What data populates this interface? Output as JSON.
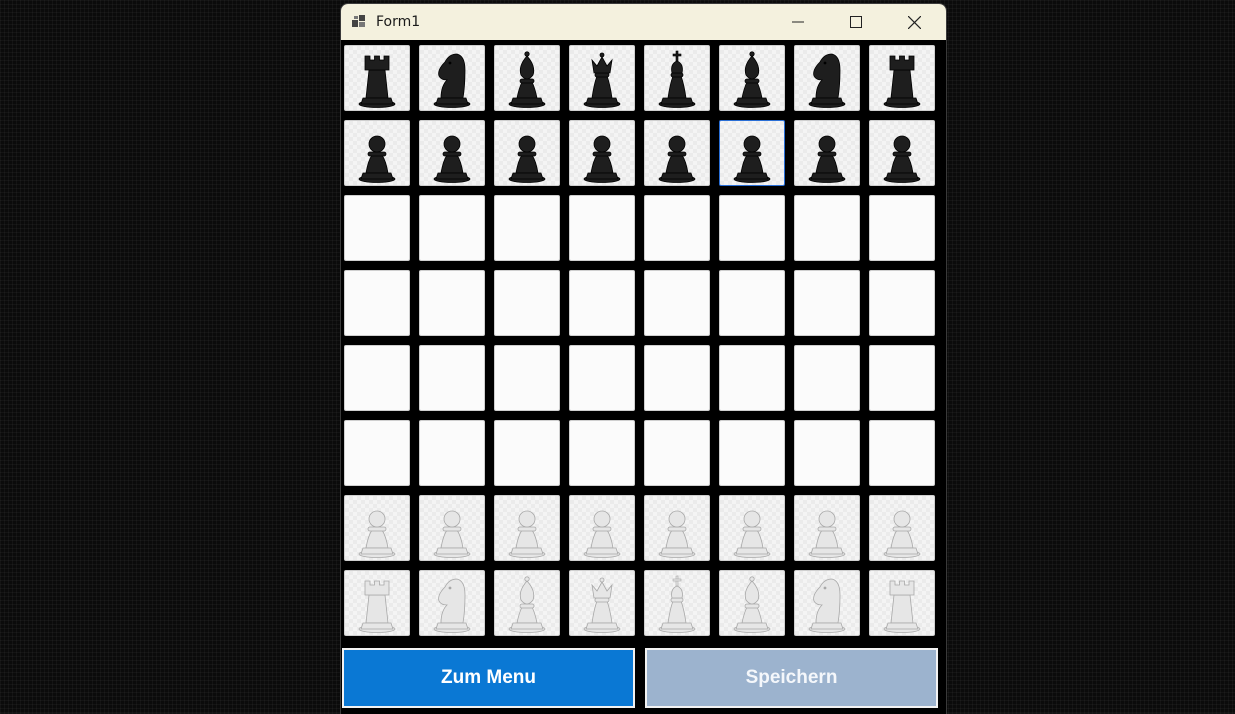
{
  "window": {
    "title": "Form1"
  },
  "board": {
    "rows": [
      [
        "black-rook",
        "black-knight",
        "black-bishop",
        "black-queen",
        "black-king",
        "black-bishop",
        "black-knight",
        "black-rook"
      ],
      [
        "black-pawn",
        "black-pawn",
        "black-pawn",
        "black-pawn",
        "black-pawn",
        "black-pawn",
        "black-pawn",
        "black-pawn"
      ],
      [
        "",
        "",
        "",
        "",
        "",
        "",
        "",
        ""
      ],
      [
        "",
        "",
        "",
        "",
        "",
        "",
        "",
        ""
      ],
      [
        "",
        "",
        "",
        "",
        "",
        "",
        "",
        ""
      ],
      [
        "",
        "",
        "",
        "",
        "",
        "",
        "",
        ""
      ],
      [
        "white-pawn",
        "white-pawn",
        "white-pawn",
        "white-pawn",
        "white-pawn",
        "white-pawn",
        "white-pawn",
        "white-pawn"
      ],
      [
        "white-rook",
        "white-knight",
        "white-bishop",
        "white-queen",
        "white-king",
        "white-bishop",
        "white-knight",
        "white-rook"
      ]
    ],
    "selected": {
      "row": 1,
      "col": 5
    }
  },
  "buttons": {
    "menu_label": "Zum Menu",
    "save_label": "Speichern"
  },
  "colors": {
    "menu_button": "#0a78d4",
    "save_button": "#9cb3ce",
    "black_piece": "#1e1e1e",
    "white_piece": "#e6e6e6"
  }
}
